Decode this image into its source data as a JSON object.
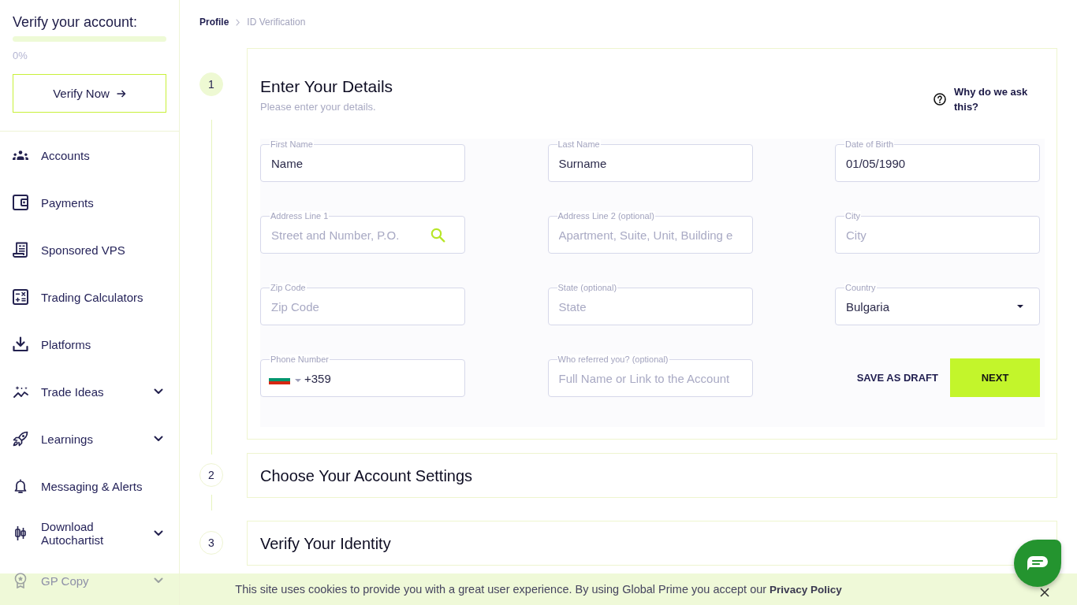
{
  "sidebar": {
    "verification": {
      "title": "Verify your account:",
      "level": 0,
      "percent": "0%",
      "button": "Verify Now"
    },
    "items": [
      {
        "label": "Accounts",
        "expandable": false
      },
      {
        "label": "Payments",
        "expandable": false
      },
      {
        "label": "Sponsored VPS",
        "expandable": false
      },
      {
        "label": "Trading Calculators",
        "expandable": false
      },
      {
        "label": "Platforms",
        "expandable": false
      },
      {
        "label": "Trade Ideas",
        "expandable": true
      },
      {
        "label": "Learnings",
        "expandable": true
      },
      {
        "label": "Messaging & Alerts",
        "expandable": false
      },
      {
        "label": "Download Autochartist",
        "expandable": true
      },
      {
        "label": "GP Copy",
        "expandable": true
      }
    ]
  },
  "breadcrumb": [
    {
      "label": "Profile",
      "current": false
    },
    {
      "label": "ID Verification",
      "current": true
    }
  ],
  "steps": [
    {
      "number": "1",
      "title": "Enter Your Details",
      "active": true,
      "form": {
        "subtitle": "Please enter your details.",
        "help_link": "Why do we ask this?",
        "fields": [
          {
            "kind": "text",
            "label": "First Name",
            "value": "Name"
          },
          {
            "kind": "text",
            "label": "Last Name",
            "value": "Surname"
          },
          {
            "kind": "text",
            "label": "Date of Birth",
            "value": "01/05/1990"
          },
          {
            "kind": "search",
            "label": "Address Line 1",
            "placeholder": "Street and Number, P.O."
          },
          {
            "kind": "text",
            "label": "Address Line 2 (optional)",
            "placeholder": "Apartment, Suite, Unit, Building e"
          },
          {
            "kind": "text",
            "label": "City",
            "placeholder": "City"
          },
          {
            "kind": "text",
            "label": "Zip Code",
            "placeholder": "Zip Code"
          },
          {
            "kind": "text",
            "label": "State (optional)",
            "placeholder": "State"
          },
          {
            "kind": "select",
            "label": "Country",
            "value": "Bulgaria"
          },
          {
            "kind": "phone",
            "label": "Phone Number",
            "value": "+359"
          },
          {
            "kind": "text",
            "label": "Who referred you? (optional)",
            "placeholder": "Full Name or Link to the Account"
          }
        ],
        "buttons": [
          {
            "kind": "text",
            "label": "SAVE AS DRAFT"
          },
          {
            "kind": "primary",
            "label": "NEXT"
          }
        ]
      }
    },
    {
      "number": "2",
      "title": "Choose Your Account Settings",
      "active": false
    },
    {
      "number": "3",
      "title": "Verify Your Identity",
      "active": false
    }
  ],
  "cookie_banner": {
    "text": "This site uses cookies to provide you with a great user experience. By using Global Prime you accept our",
    "link": "Privacy Policy"
  }
}
